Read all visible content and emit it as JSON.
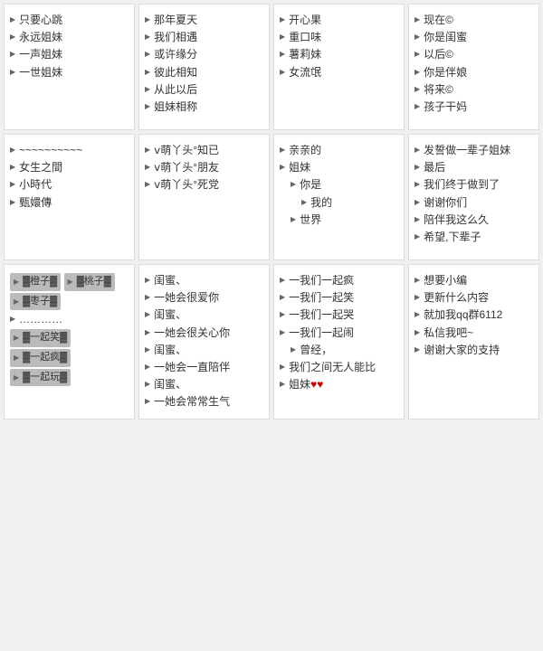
{
  "grid": {
    "rows": [
      [
        {
          "id": "card-1-1",
          "items": [
            {
              "text": "只要心跳",
              "indent": 0
            },
            {
              "text": "永远姐妹",
              "indent": 0
            },
            {
              "text": "一声姐妹",
              "indent": 0
            },
            {
              "text": "一世姐妹",
              "indent": 0
            }
          ]
        },
        {
          "id": "card-1-2",
          "items": [
            {
              "text": "那年夏天",
              "indent": 0
            },
            {
              "text": "我们相遇",
              "indent": 0
            },
            {
              "text": "或许缘分",
              "indent": 0
            },
            {
              "text": "彼此相知",
              "indent": 0
            },
            {
              "text": "从此以后",
              "indent": 0
            },
            {
              "text": "姐妹相称",
              "indent": 0
            }
          ]
        },
        {
          "id": "card-1-3",
          "items": [
            {
              "text": "开心果",
              "indent": 0
            },
            {
              "text": "重口味",
              "indent": 0
            },
            {
              "text": "薯莉妹",
              "indent": 0
            },
            {
              "text": "女流氓",
              "indent": 0
            }
          ]
        },
        {
          "id": "card-1-4",
          "items": [
            {
              "text": "现在©",
              "indent": 0
            },
            {
              "text": "你是闺蜜",
              "indent": 0
            },
            {
              "text": "以后©",
              "indent": 0
            },
            {
              "text": "你是伴娘",
              "indent": 0
            },
            {
              "text": "将来©",
              "indent": 0
            },
            {
              "text": "孩子干妈",
              "indent": 0
            }
          ]
        }
      ],
      [
        {
          "id": "card-2-1",
          "items": [
            {
              "text": "~~~~~~~~~~",
              "indent": 0
            },
            {
              "text": "女生之間",
              "indent": 0
            },
            {
              "text": "小時代",
              "indent": 0
            },
            {
              "text": "甄嬛傳",
              "indent": 0
            }
          ]
        },
        {
          "id": "card-2-2",
          "items": [
            {
              "text": "ⅴ萌丫头°知已",
              "indent": 0
            },
            {
              "text": "ⅴ萌丫头°朋友",
              "indent": 0
            },
            {
              "text": "ⅴ萌丫头°死党",
              "indent": 0
            }
          ]
        },
        {
          "id": "card-2-3",
          "items": [
            {
              "text": "亲亲的",
              "indent": 0
            },
            {
              "text": "姐妹",
              "indent": 0
            },
            {
              "text": "你是",
              "indent": 1
            },
            {
              "text": "我的",
              "indent": 2
            },
            {
              "text": "世界",
              "indent": 1
            }
          ]
        },
        {
          "id": "card-2-4",
          "items": [
            {
              "text": "发誓做一辈子姐妹",
              "indent": 0
            },
            {
              "text": "最后",
              "indent": 0
            },
            {
              "text": "我们终于做到了",
              "indent": 0
            },
            {
              "text": "谢谢你们",
              "indent": 0
            },
            {
              "text": "陪伴我这么久",
              "indent": 0
            },
            {
              "text": "希望,下辈子",
              "indent": 0
            }
          ]
        }
      ],
      [
        {
          "id": "card-3-1",
          "items": [
            {
              "text": "▓橙子▓",
              "type": "block"
            },
            {
              "text": "▓桃子▓",
              "type": "block"
            },
            {
              "text": "▓枣子▓",
              "type": "block"
            },
            {
              "text": "…………",
              "indent": 0
            },
            {
              "text": "▓一起笑▓",
              "type": "block"
            },
            {
              "text": "▓一起疯▓",
              "type": "block"
            },
            {
              "text": "▓一起玩▓",
              "type": "block"
            }
          ]
        },
        {
          "id": "card-3-2",
          "items": [
            {
              "text": "闺蜜、",
              "indent": 0
            },
            {
              "text": "一她会很爱你",
              "indent": 0
            },
            {
              "text": "闺蜜、",
              "indent": 0
            },
            {
              "text": "一她会很关心你",
              "indent": 0
            },
            {
              "text": "闺蜜、",
              "indent": 0
            },
            {
              "text": "一她会一直陪伴",
              "indent": 0
            },
            {
              "text": "闺蜜、",
              "indent": 0
            },
            {
              "text": "一她会常常生气",
              "indent": 0
            }
          ]
        },
        {
          "id": "card-3-3",
          "items": [
            {
              "text": "一我们一起疯",
              "indent": 0
            },
            {
              "text": "一我们一起笑",
              "indent": 0
            },
            {
              "text": "一我们一起哭",
              "indent": 0
            },
            {
              "text": "一我们一起闹",
              "indent": 0
            },
            {
              "text": "曾经，",
              "indent": 1
            },
            {
              "text": "我们之间无人能比",
              "indent": 0
            },
            {
              "text": "姐妹 ♥♥",
              "indent": 0
            }
          ]
        },
        {
          "id": "card-3-4",
          "items": [
            {
              "text": "想要小编",
              "indent": 0
            },
            {
              "text": "更新什么内容",
              "indent": 0
            },
            {
              "text": "就加我qq群6112",
              "indent": 0
            },
            {
              "text": "私信我吧~",
              "indent": 0
            },
            {
              "text": "谢谢大家的支持",
              "indent": 0
            }
          ]
        }
      ]
    ]
  }
}
